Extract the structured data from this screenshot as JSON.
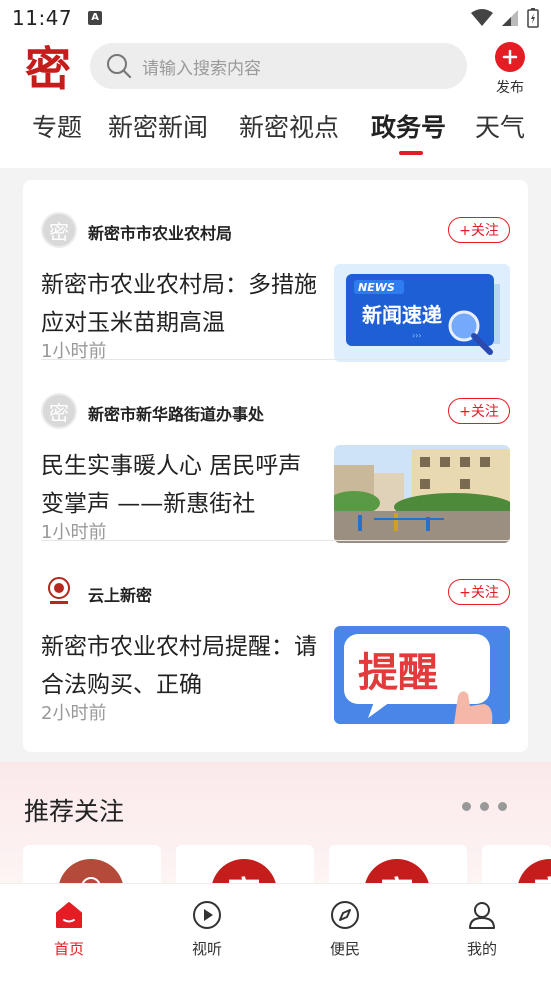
{
  "status_bar": {
    "time": "11:47",
    "notification_icon": "A"
  },
  "header": {
    "logo_char": "密",
    "search_placeholder": "请输入搜索内容",
    "publish_label": "发布"
  },
  "tabs": [
    {
      "label": "专题",
      "active": false
    },
    {
      "label": "新密新闻",
      "active": false
    },
    {
      "label": "新密视点",
      "active": false
    },
    {
      "label": "政务号",
      "active": true
    },
    {
      "label": "天气",
      "active": false
    }
  ],
  "feed": [
    {
      "source": "新密市市农业农村局",
      "avatar_char": "密",
      "follow_label": "+关注",
      "title": "新密市农业农村局：多措施应对玉米苗期高温",
      "time": "1小时前",
      "thumb": {
        "type": "news-graphic",
        "badge": "NEWS",
        "headline": "新闻速递"
      }
    },
    {
      "source": "新密市新华路街道办事处",
      "avatar_char": "密",
      "follow_label": "+关注",
      "title": "民生实事暖人心 居民呼声变掌声 ——新惠街社",
      "time": "1小时前",
      "thumb": {
        "type": "photo-playground"
      }
    },
    {
      "source": "云上新密",
      "avatar_char": "",
      "follow_label": "+关注",
      "title": "新密市农业农村局提醒：请合法购买、正确",
      "time": "2小时前",
      "thumb": {
        "type": "reminder-graphic",
        "headline": "提醒"
      }
    }
  ],
  "recommend": {
    "title": "推荐关注",
    "card_logo_char": "密"
  },
  "bottom_nav": [
    {
      "label": "首页",
      "icon": "home-icon",
      "active": true
    },
    {
      "label": "视听",
      "icon": "play-icon",
      "active": false
    },
    {
      "label": "便民",
      "icon": "compass-icon",
      "active": false
    },
    {
      "label": "我的",
      "icon": "user-icon",
      "active": false
    }
  ],
  "colors": {
    "accent": "#e51c23",
    "brand": "#c51c1c"
  }
}
